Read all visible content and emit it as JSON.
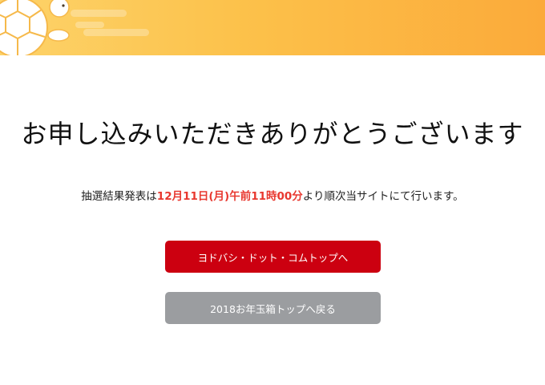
{
  "heading": "お申し込みいただきありがとうございます",
  "notice": {
    "before": "抽選結果発表は",
    "date": "12月11日(月)午前11時00分",
    "after": "より順次当サイトにて行います。"
  },
  "buttons": {
    "top_label": "ヨドバシ・ドット・コムトップへ",
    "back_label": "2018お年玉箱トップへ戻る"
  },
  "colors": {
    "banner_gradient": [
      "#fdd36a",
      "#fbaa3a"
    ],
    "primary_button": "#cc0010",
    "secondary_button": "#9b9da0",
    "highlight_text": "#e8382f"
  },
  "icons": {
    "banner_illustration": "turtle-icon"
  }
}
